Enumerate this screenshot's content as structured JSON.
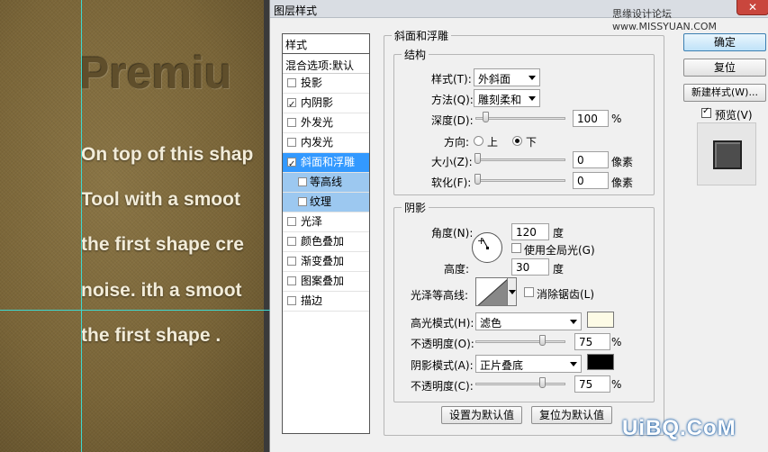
{
  "canvas": {
    "headline": "Premiu",
    "lines": [
      "On top of this shap",
      "Tool with a smoot",
      "the first shape cre",
      "noise. ith a smoot",
      "the first shape ."
    ]
  },
  "dialog": {
    "title": "图层样式",
    "watermark_top": "思缘设计论坛 www.MISSYUAN.COM",
    "close_label": "✕",
    "styles_header": "样式",
    "blend_options": "混合选项:默认",
    "style_items": [
      {
        "label": "投影",
        "checked": false
      },
      {
        "label": "内阴影",
        "checked": true
      },
      {
        "label": "外发光",
        "checked": false
      },
      {
        "label": "内发光",
        "checked": false
      },
      {
        "label": "斜面和浮雕",
        "checked": true,
        "selected": true
      },
      {
        "label": "等高线",
        "checked": false,
        "sub": true
      },
      {
        "label": "纹理",
        "checked": false,
        "sub": true
      },
      {
        "label": "光泽",
        "checked": false
      },
      {
        "label": "颜色叠加",
        "checked": false
      },
      {
        "label": "渐变叠加",
        "checked": false
      },
      {
        "label": "图案叠加",
        "checked": false
      },
      {
        "label": "描边",
        "checked": false
      }
    ],
    "bevel": {
      "group_title": "斜面和浮雕",
      "structure_title": "结构",
      "style_label": "样式(T):",
      "style_value": "外斜面",
      "technique_label": "方法(Q):",
      "technique_value": "雕刻柔和",
      "depth_label": "深度(D):",
      "depth_value": "100",
      "depth_unit": "%",
      "direction_label": "方向:",
      "direction_up": "上",
      "direction_down": "下",
      "direction_selected": "down",
      "size_label": "大小(Z):",
      "size_value": "0",
      "size_unit": "像素",
      "soften_label": "软化(F):",
      "soften_value": "0",
      "soften_unit": "像素"
    },
    "shading": {
      "title": "阴影",
      "angle_label": "角度(N):",
      "angle_value": "120",
      "angle_unit": "度",
      "global_light_label": "使用全局光(G)",
      "global_light": false,
      "altitude_label": "高度:",
      "altitude_value": "30",
      "altitude_unit": "度",
      "gloss_contour_label": "光泽等高线:",
      "anti_alias_label": "消除锯齿(L)",
      "anti_alias": false,
      "highlight_mode_label": "高光模式(H):",
      "highlight_mode_value": "滤色",
      "highlight_color": "#fdfbe6",
      "highlight_opacity_label": "不透明度(O):",
      "highlight_opacity_value": "75",
      "shadow_mode_label": "阴影模式(A):",
      "shadow_mode_value": "正片叠底",
      "shadow_color": "#000000",
      "shadow_opacity_label": "不透明度(C):",
      "shadow_opacity_value": "75",
      "percent": "%"
    },
    "buttons": {
      "make_default": "设置为默认值",
      "reset_default": "复位为默认值",
      "ok": "确定",
      "reset": "复位",
      "new_style": "新建样式(W)...",
      "preview_label": "预览(V)",
      "preview": true
    },
    "watermark_bottom": "UiBQ.CoM"
  }
}
